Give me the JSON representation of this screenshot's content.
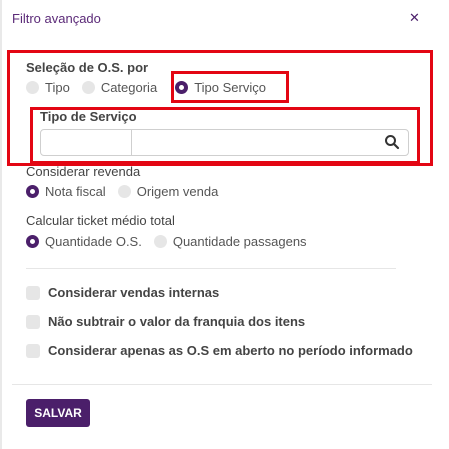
{
  "header": {
    "title": "Filtro avançado",
    "close_icon": "close-icon"
  },
  "selecao": {
    "label": "Seleção de O.S. por",
    "options": [
      {
        "label": "Tipo",
        "selected": false
      },
      {
        "label": "Categoria",
        "selected": false
      },
      {
        "label": "Tipo Serviço",
        "selected": true
      }
    ]
  },
  "tipo_servico": {
    "label": "Tipo de Serviço",
    "value_left": "",
    "value_right": "",
    "search_icon": "search-icon"
  },
  "revenda": {
    "label": "Considerar revenda",
    "options": [
      {
        "label": "Nota fiscal",
        "selected": true
      },
      {
        "label": "Origem venda",
        "selected": false
      }
    ]
  },
  "ticket": {
    "label": "Calcular ticket médio total",
    "options": [
      {
        "label": "Quantidade O.S.",
        "selected": true
      },
      {
        "label": "Quantidade passagens",
        "selected": false
      }
    ]
  },
  "checks": [
    {
      "label": "Considerar vendas internas",
      "checked": false
    },
    {
      "label": "Não subtrair o valor da franquia dos itens",
      "checked": false
    },
    {
      "label": "Considerar apenas as O.S em aberto no período informado",
      "checked": false
    }
  ],
  "footer": {
    "save_label": "SALVAR"
  },
  "colors": {
    "accent": "#4b1f6a",
    "highlight": "#e30613",
    "title": "#5b2a78"
  }
}
